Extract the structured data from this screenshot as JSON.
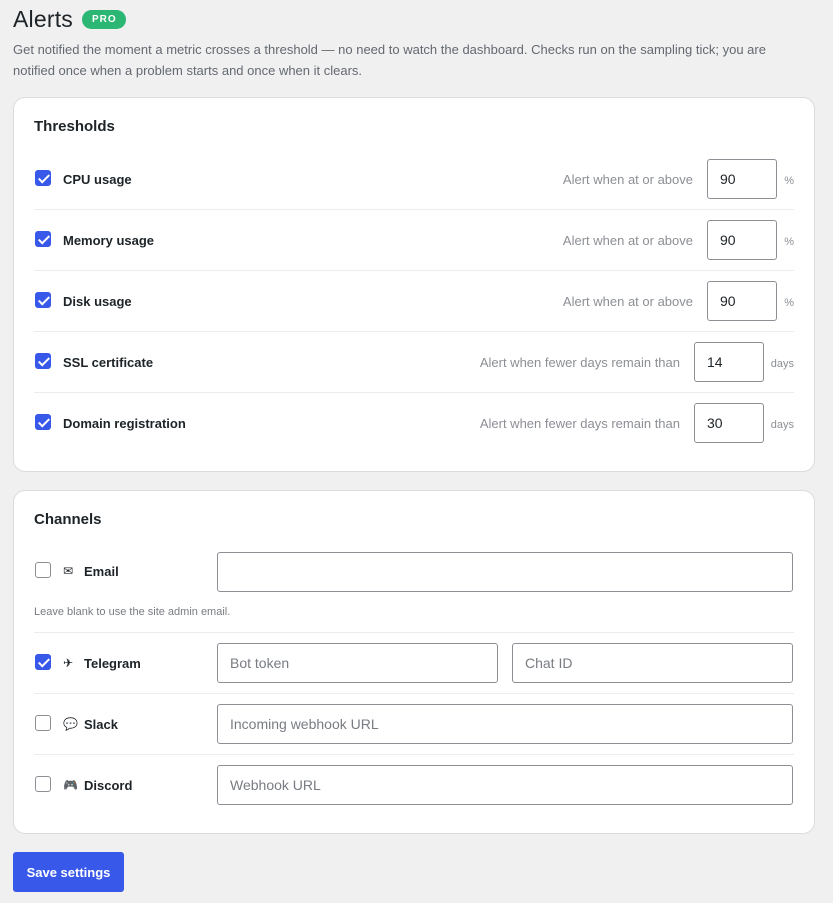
{
  "header": {
    "title": "Alerts",
    "badge": "PRO",
    "description": "Get notified the moment a metric crosses a threshold — no need to watch the dashboard. Checks run on the sampling tick; you are notified once when a problem starts and once when it clears."
  },
  "thresholds": {
    "title": "Thresholds",
    "rows": [
      {
        "label": "CPU usage",
        "checked": true,
        "hint": "Alert when at or above",
        "value": "90",
        "unit": "%"
      },
      {
        "label": "Memory usage",
        "checked": true,
        "hint": "Alert when at or above",
        "value": "90",
        "unit": "%"
      },
      {
        "label": "Disk usage",
        "checked": true,
        "hint": "Alert when at or above",
        "value": "90",
        "unit": "%"
      },
      {
        "label": "SSL certificate",
        "checked": true,
        "hint": "Alert when fewer days remain than",
        "value": "14",
        "unit": "days"
      },
      {
        "label": "Domain registration",
        "checked": true,
        "hint": "Alert when fewer days remain than",
        "value": "30",
        "unit": "days"
      }
    ]
  },
  "channels": {
    "title": "Channels",
    "email": {
      "label": "Email",
      "checked": false,
      "icon": "envelope-icon",
      "value": "",
      "help": "Leave blank to use the site admin email."
    },
    "telegram": {
      "label": "Telegram",
      "checked": true,
      "icon": "airplane-icon",
      "token_placeholder": "Bot token",
      "chat_placeholder": "Chat ID"
    },
    "slack": {
      "label": "Slack",
      "checked": false,
      "icon": "speech-bubble-icon",
      "placeholder": "Incoming webhook URL"
    },
    "discord": {
      "label": "Discord",
      "checked": false,
      "icon": "game-controller-icon",
      "placeholder": "Webhook URL"
    }
  },
  "actions": {
    "save_label": "Save settings"
  },
  "colors": {
    "accent": "#3858e9",
    "badge": "#2bb673",
    "background": "#f0f0f1"
  }
}
